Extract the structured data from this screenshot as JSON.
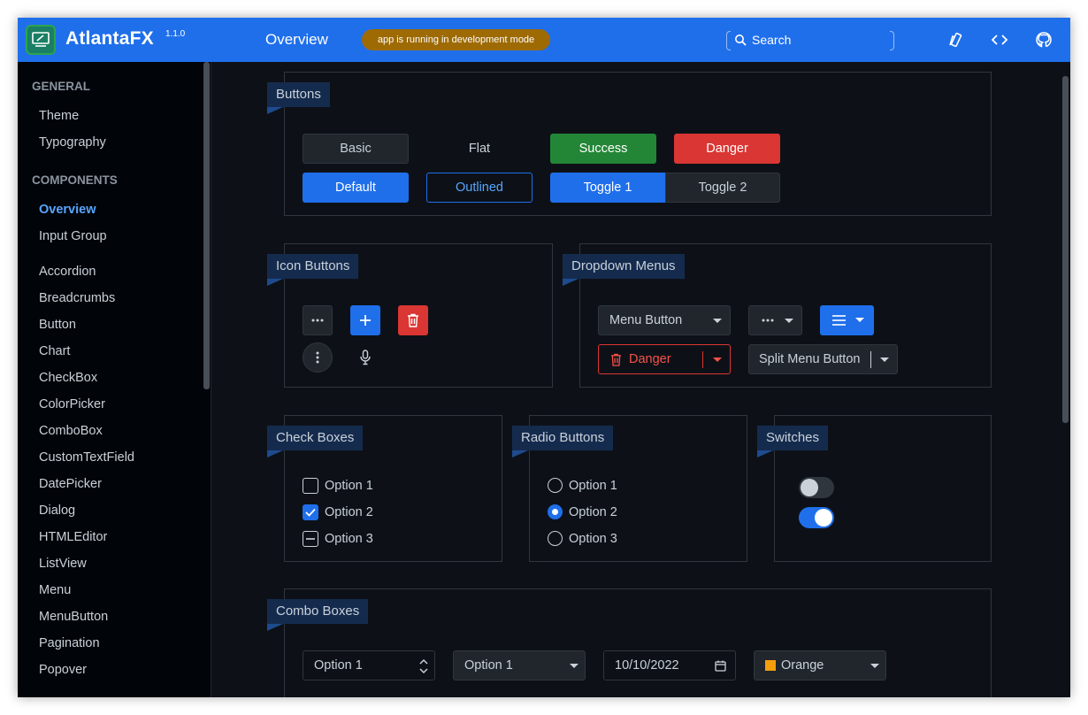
{
  "header": {
    "app_name": "AtlantaFX",
    "version": "1.1.0",
    "page_title": "Overview",
    "dev_badge": "app is running in development mode",
    "search_label": "Search",
    "accent_color": "#1f6feb",
    "icons": [
      "theme-icon",
      "source-code-icon",
      "github-icon"
    ]
  },
  "sidebar": {
    "section_general": "GENERAL",
    "general_items": [
      "Theme",
      "Typography"
    ],
    "section_components": "COMPONENTS",
    "component_items": [
      "Overview",
      "Input Group",
      "Accordion",
      "Breadcrumbs",
      "Button",
      "Chart",
      "CheckBox",
      "ColorPicker",
      "ComboBox",
      "CustomTextField",
      "DatePicker",
      "Dialog",
      "HTMLEditor",
      "ListView",
      "Menu",
      "MenuButton",
      "Pagination",
      "Popover"
    ],
    "active_item": "Overview"
  },
  "buttons_card": {
    "title": "Buttons",
    "basic": "Basic",
    "flat": "Flat",
    "success": "Success",
    "danger": "Danger",
    "default": "Default",
    "outlined": "Outlined",
    "toggle1": "Toggle 1",
    "toggle2": "Toggle 2"
  },
  "icon_buttons_card": {
    "title": "Icon Buttons",
    "icons": [
      "more-horizontal-icon",
      "plus-icon",
      "trash-icon",
      "more-vertical-icon",
      "microphone-icon"
    ]
  },
  "dropdown_card": {
    "title": "Dropdown Menus",
    "menu_button": "Menu Button",
    "danger": "Danger",
    "split_menu_button": "Split Menu Button"
  },
  "checkboxes_card": {
    "title": "Check Boxes",
    "options": [
      {
        "label": "Option 1",
        "state": "unchecked"
      },
      {
        "label": "Option 2",
        "state": "checked"
      },
      {
        "label": "Option 3",
        "state": "indeterminate"
      }
    ]
  },
  "radio_card": {
    "title": "Radio Buttons",
    "options": [
      {
        "label": "Option 1",
        "selected": false
      },
      {
        "label": "Option 2",
        "selected": true
      },
      {
        "label": "Option 3",
        "selected": false
      }
    ]
  },
  "switches_card": {
    "title": "Switches",
    "states": [
      false,
      true
    ]
  },
  "combo_card": {
    "title": "Combo Boxes",
    "spinner_value": "Option 1",
    "combo_value": "Option 1",
    "date_value": "10/10/2022",
    "color_value": "Orange",
    "color_swatch": "#f59e0b"
  }
}
